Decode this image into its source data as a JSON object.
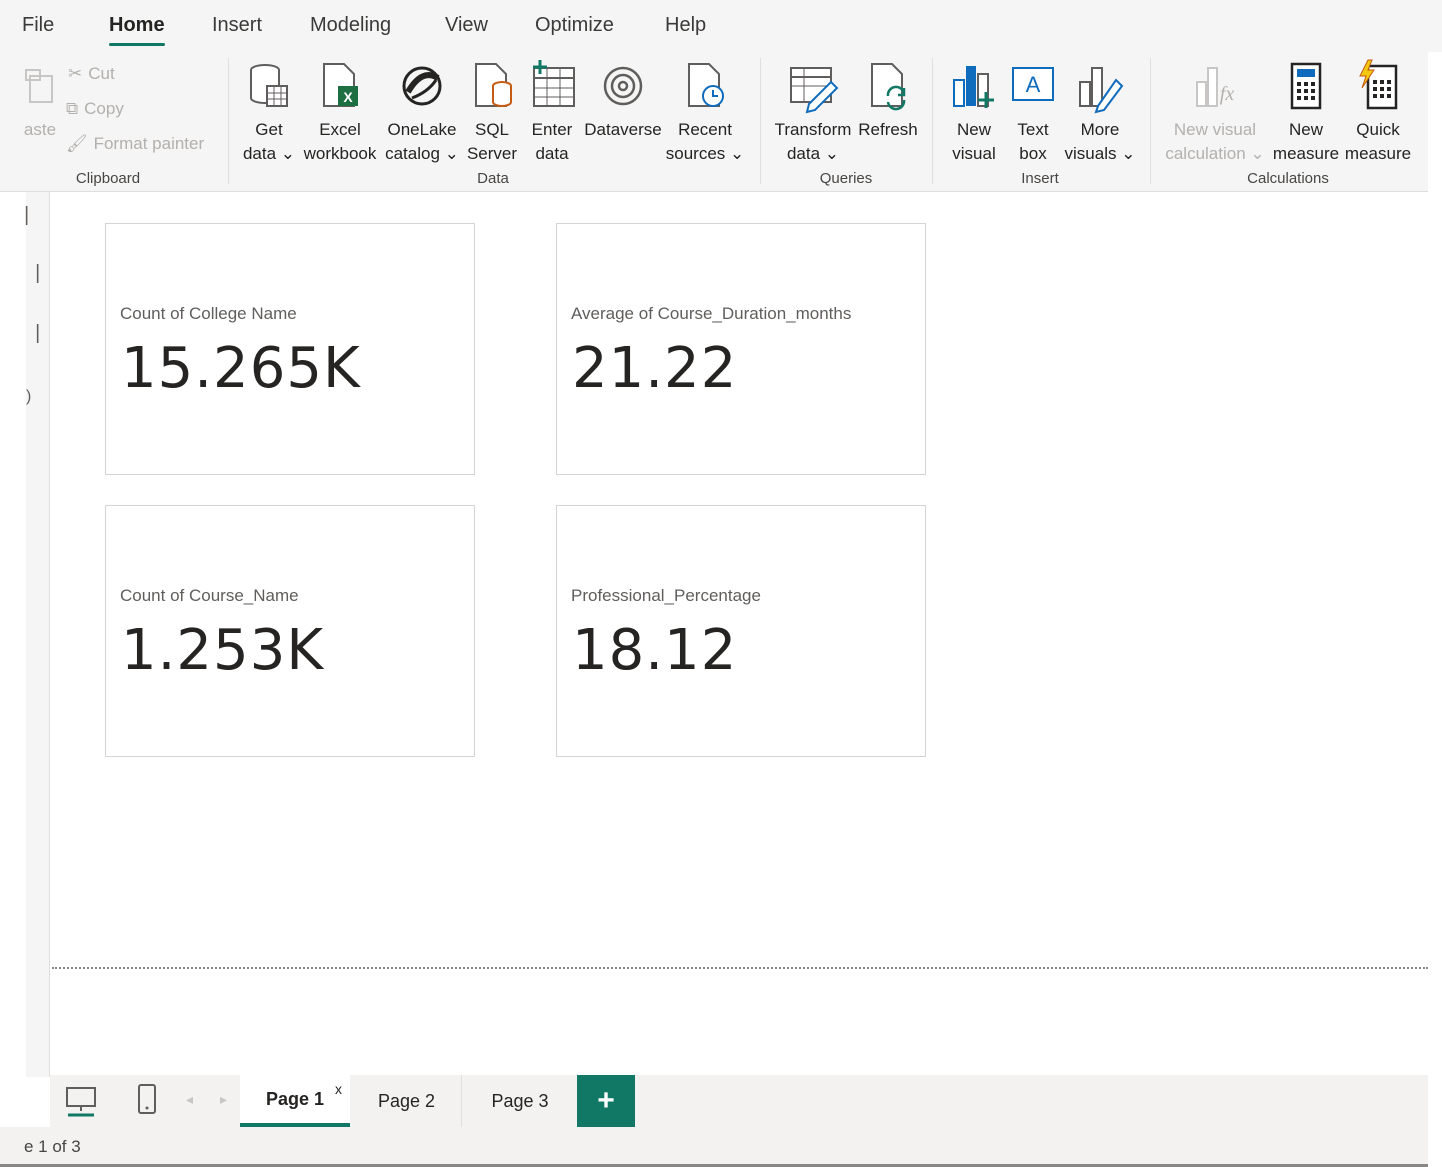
{
  "menu": {
    "items": [
      "File",
      "Home",
      "Insert",
      "Modeling",
      "View",
      "Optimize",
      "Help"
    ]
  },
  "ribbon": {
    "clipboard": {
      "paste": "aste",
      "cut": "Cut",
      "copy": "Copy",
      "format_painter": "Format painter",
      "group": "Clipboard"
    },
    "data": {
      "get_data": "Get\ndata ⌄",
      "excel": "Excel\nworkbook",
      "onelake": "OneLake\ncatalog ⌄",
      "sql": "SQL\nServer",
      "enter": "Enter\ndata",
      "dataverse": "Dataverse",
      "recent": "Recent\nsources ⌄",
      "group": "Data"
    },
    "queries": {
      "transform": "Transform\ndata ⌄",
      "refresh": "Refresh",
      "group": "Queries"
    },
    "insert": {
      "new_visual": "New\nvisual",
      "text_box": "Text\nbox",
      "more_visuals": "More\nvisuals ⌄",
      "group": "Insert"
    },
    "calculations": {
      "new_visual_calc": "New visual\ncalculation ⌄",
      "new_measure": "New\nmeasure",
      "quick_measure": "Quick\nmeasure",
      "group": "Calculations"
    }
  },
  "cards": [
    {
      "label": "Count of College Name",
      "value": "15.265K"
    },
    {
      "label": "Average of Course_Duration_months",
      "value": "21.22"
    },
    {
      "label": "Count of Course_Name",
      "value": "1.253K"
    },
    {
      "label": "Professional_Percentage",
      "value": "18.12"
    }
  ],
  "tabs": {
    "page1": "Page 1",
    "page2": "Page 2",
    "page3": "Page 3",
    "close": "x",
    "add": "+"
  },
  "status": {
    "text": "e 1 of 3"
  },
  "colors": {
    "accent": "#117865",
    "ribbon_bg": "#f5f5f5",
    "excel_green": "#1d6f42",
    "power_bi_yellow": "#f2c811"
  }
}
